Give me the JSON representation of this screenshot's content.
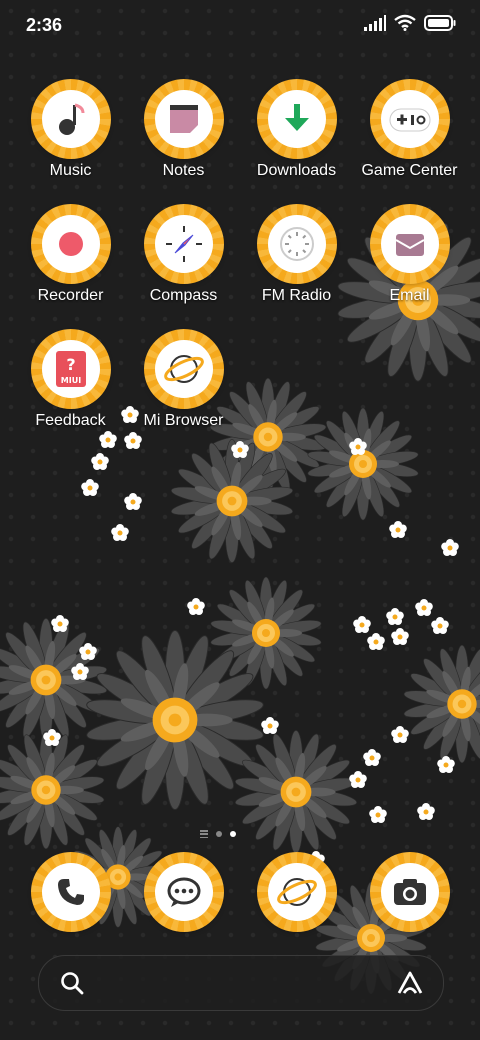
{
  "status_bar": {
    "time": "2:36",
    "icons": [
      "signal-icon",
      "wifi-icon",
      "battery-icon"
    ]
  },
  "apps": [
    {
      "label": "Music",
      "icon": "music-note-icon"
    },
    {
      "label": "Notes",
      "icon": "notes-icon"
    },
    {
      "label": "Downloads",
      "icon": "download-arrow-icon"
    },
    {
      "label": "Game Center",
      "icon": "gamepad-icon"
    },
    {
      "label": "Recorder",
      "icon": "record-dot-icon"
    },
    {
      "label": "Compass",
      "icon": "compass-icon"
    },
    {
      "label": "FM Radio",
      "icon": "radio-dial-icon"
    },
    {
      "label": "Email",
      "icon": "envelope-icon"
    },
    {
      "label": "Feedback",
      "icon": "feedback-miui-icon",
      "badge_text": "MIUI"
    },
    {
      "label": "Mi Browser",
      "icon": "planet-icon"
    }
  ],
  "dock": [
    {
      "name": "phone",
      "icon": "phone-icon"
    },
    {
      "name": "messages",
      "icon": "chat-bubble-icon"
    },
    {
      "name": "browser",
      "icon": "planet-icon"
    },
    {
      "name": "camera",
      "icon": "camera-icon"
    }
  ],
  "page_indicator": {
    "pages": 2,
    "current": 2
  },
  "search": {
    "icon": "search-icon",
    "assistant_icon": "assistant-a-icon"
  },
  "colors": {
    "accent": "#f5a91d",
    "background": "#1e1e1e"
  }
}
